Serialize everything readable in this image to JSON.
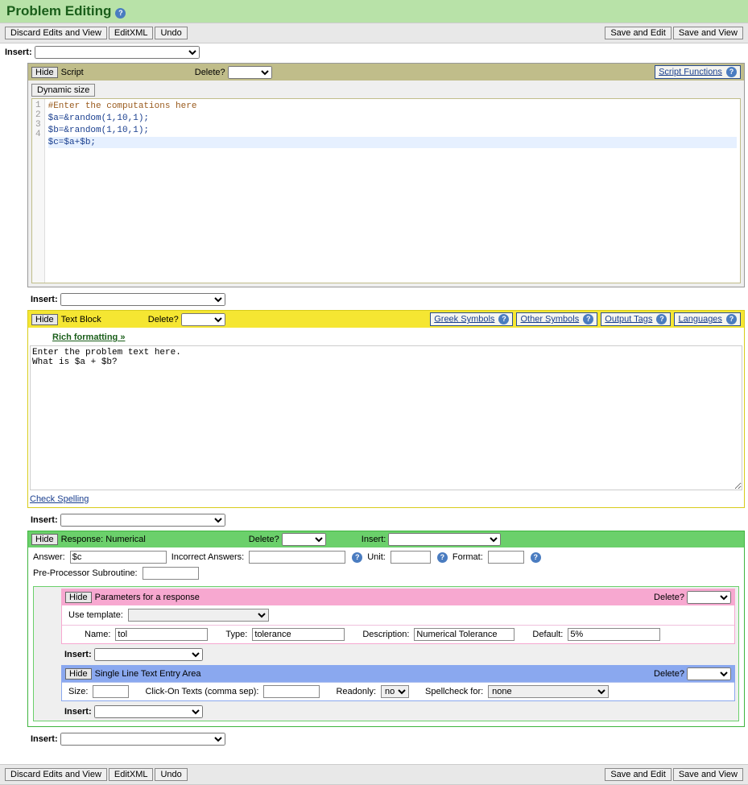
{
  "title": "Problem Editing",
  "buttons": {
    "discard": "Discard Edits and View",
    "editxml": "EditXML",
    "undo": "Undo",
    "saveedit": "Save and Edit",
    "saveview": "Save and View",
    "hide": "Hide",
    "dynsize": "Dynamic size"
  },
  "labels": {
    "insert": "Insert:",
    "delete": "Delete?",
    "script": "Script",
    "script_functions": "Script Functions",
    "textblock": "Text Block",
    "greek": "Greek Symbols",
    "other_symbols": "Other Symbols",
    "output_tags": "Output Tags",
    "languages": "Languages",
    "rich_formatting": "Rich formatting »",
    "check_spelling": "Check Spelling",
    "response_num": "Response: Numerical",
    "answer": "Answer:",
    "incorrect": "Incorrect Answers:",
    "unit": "Unit:",
    "format": "Format:",
    "preproc": "Pre-Processor Subroutine:",
    "params": "Parameters for a response",
    "use_template": "Use template:",
    "pname": "Name:",
    "ptype": "Type:",
    "pdesc": "Description:",
    "pdefault": "Default:",
    "textline": "Single Line Text Entry Area",
    "size": "Size:",
    "clickon": "Click-On Texts (comma sep):",
    "readonly": "Readonly:",
    "spellcheck": "Spellcheck for:"
  },
  "code": {
    "l1": "#Enter the computations here",
    "l2": "$a=&random(1,10,1);",
    "l3": "$b=&random(1,10,1);",
    "l4": "$c=$a+$b;"
  },
  "textblock_value": "Enter the problem text here.\nWhat is $a + $b?",
  "response": {
    "answer": "$c",
    "param_name": "tol",
    "param_type": "tolerance",
    "param_desc": "Numerical Tolerance",
    "param_default": "5%",
    "readonly_val": "no",
    "spellcheck_val": "none"
  }
}
